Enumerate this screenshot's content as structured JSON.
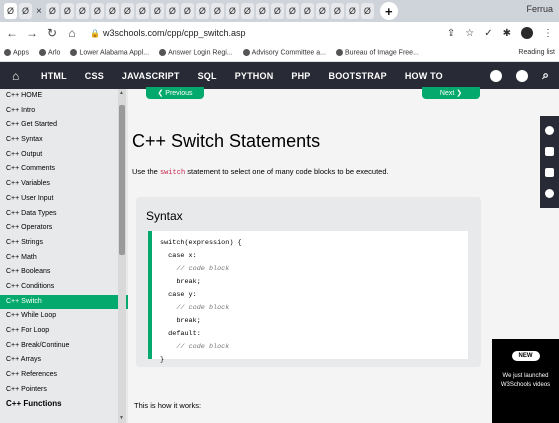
{
  "browser": {
    "tabs": [
      "Ø",
      "Ø",
      "Ø",
      "Ø",
      "Ø",
      "Ø",
      "Ø",
      "Ø",
      "Ø",
      "Ø",
      "Ø",
      "Ø",
      "Ø",
      "Ø",
      "Ø",
      "Ø",
      "Ø",
      "Ø",
      "Ø",
      "Ø",
      "Ø",
      "Ø",
      "Ø",
      "Ø"
    ],
    "new_tab": "+",
    "window_title": "Ferrua",
    "url": "w3schools.com/cpp/cpp_switch.asp",
    "bookmarks": [
      "Apps",
      "Arlo",
      "Lower Alabama Appl...",
      "Answer Login Regi...",
      "Advisory Committee a...",
      "Bureau of Image Free..."
    ],
    "bookmark_right": "Reading list"
  },
  "topnav": {
    "links": [
      "HTML",
      "CSS",
      "JAVASCRIPT",
      "SQL",
      "PYTHON",
      "PHP",
      "BOOTSTRAP",
      "HOW TO"
    ]
  },
  "sidebar": {
    "items": [
      "C++ HOME",
      "C++ Intro",
      "C++ Get Started",
      "C++ Syntax",
      "C++ Output",
      "C++ Comments",
      "C++ Variables",
      "C++ User Input",
      "C++ Data Types",
      "C++ Operators",
      "C++ Strings",
      "C++ Math",
      "C++ Booleans",
      "C++ Conditions",
      "C++ Switch",
      "C++ While Loop",
      "C++ For Loop",
      "C++ Break/Continue",
      "C++ Arrays",
      "C++ References",
      "C++ Pointers"
    ],
    "active_index": 14,
    "footer": "C++ Functions"
  },
  "main": {
    "prev": "❮ Previous",
    "next": "Next ❯",
    "title": "C++ Switch Statements",
    "intro_before": "Use the ",
    "intro_code": "switch",
    "intro_after": " statement to select one of many code blocks to be executed.",
    "syntax_title": "Syntax",
    "code_lines": [
      "switch(expression) {",
      "  case x:",
      "    // code block",
      "    break;",
      "  case y:",
      "    // code block",
      "    break;",
      "  default:",
      "    // code block",
      "}"
    ],
    "how_text": "This is how it works:"
  },
  "promo": {
    "badge": "NEW",
    "text": "We just launched W3Schools videos"
  },
  "colors": {
    "accent": "#04aa6d",
    "nav_bg": "#282a35",
    "sidebar_bg": "#e7e9eb"
  }
}
